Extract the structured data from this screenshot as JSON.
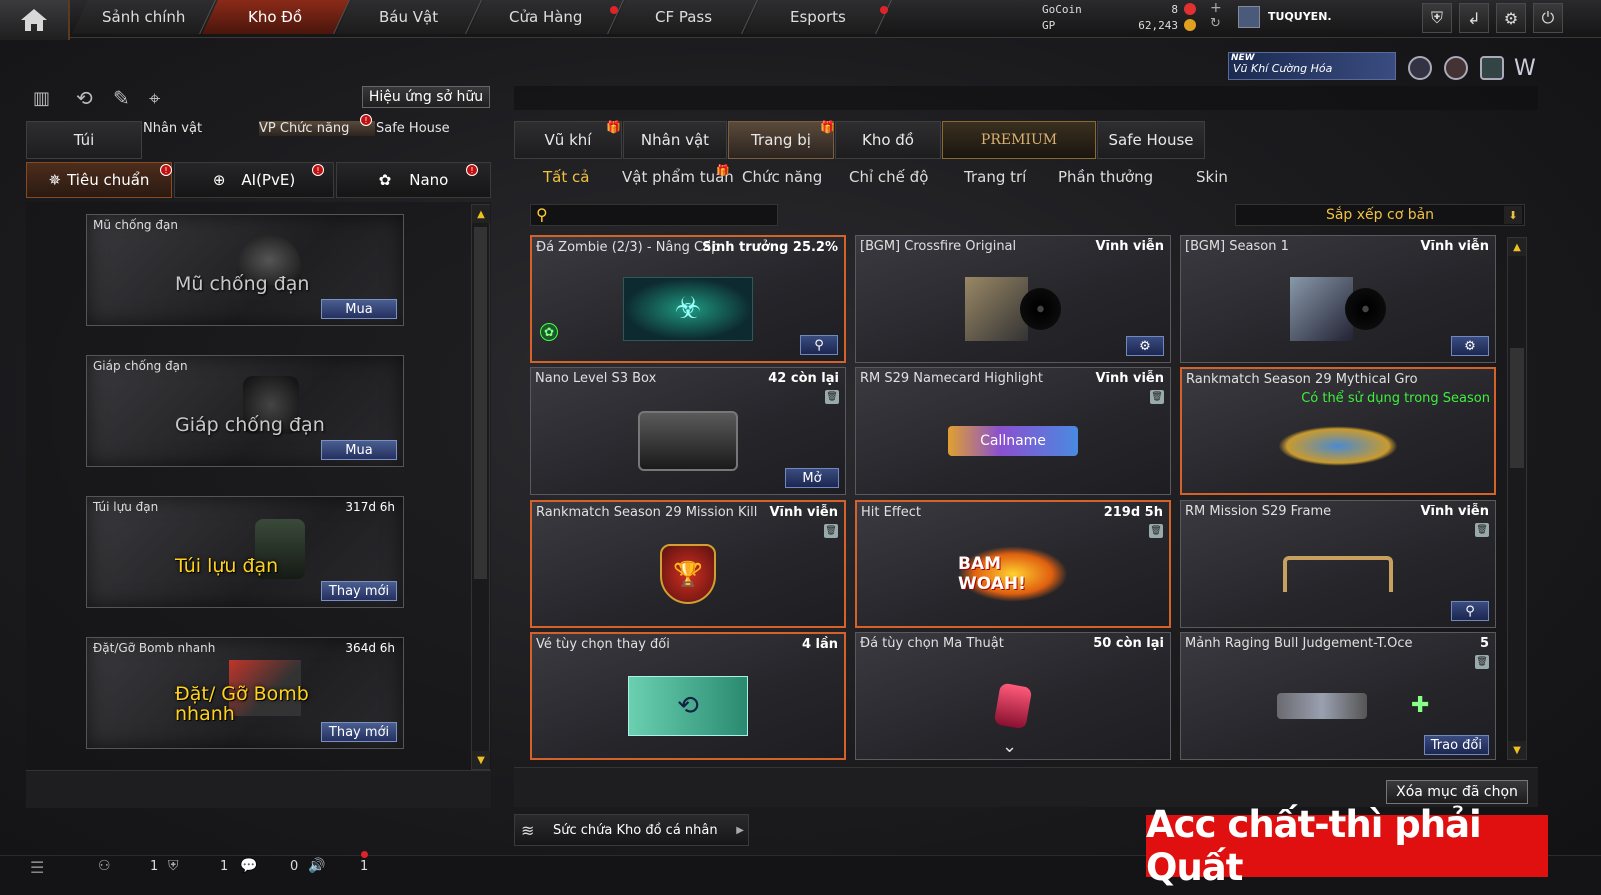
{
  "topnav": {
    "home_icon": "home-icon",
    "items": [
      {
        "label": "Sảnh chính"
      },
      {
        "label": "Kho Đồ"
      },
      {
        "label": "Báu Vật"
      },
      {
        "label": "Cửa Hàng"
      },
      {
        "label": "CF Pass"
      },
      {
        "label": "Esports"
      }
    ]
  },
  "currency": {
    "gocoin_label": "GoCoin",
    "gp_label": "GP",
    "gocoin_value": "8",
    "gp_value": "62,243"
  },
  "user": {
    "name": "TUQUYEN."
  },
  "promo_banner": {
    "new": "NEW",
    "text": "Vũ Khí Cường Hóa"
  },
  "left": {
    "effects_button": "Hiệu ứng sở hữu",
    "tabs": [
      "Túi",
      "Nhân vật",
      "VP Chức năng",
      "Safe House"
    ],
    "subtabs": [
      "Tiêu chuẩn",
      "AI(PvE)",
      "Nano"
    ],
    "items": [
      {
        "title": "Mũ chống đạn",
        "duration": "",
        "big": "Mũ chống đạn",
        "action": "Mua"
      },
      {
        "title": "Giáp chống đạn",
        "duration": "",
        "big": "Giáp chống đạn",
        "action": "Mua"
      },
      {
        "title": "Túi lựu đạn",
        "duration": "317d 6h",
        "big": "Túi lựu đạn",
        "action": "Thay mới"
      },
      {
        "title": "Đặt/Gỡ Bomb nhanh",
        "duration": "364d 6h",
        "big": "Đặt/ Gỡ Bomb nhanh",
        "action": "Thay mới"
      }
    ]
  },
  "right": {
    "tabs": [
      "Vũ khí",
      "Nhân vật",
      "Trang bị",
      "Kho đồ",
      "PREMIUM",
      "Safe House"
    ],
    "filters": [
      "Tất cả",
      "Vật phẩm tuần",
      "Chức năng",
      "Chỉ chế độ",
      "Trang trí",
      "Phần thưởng",
      "Skin"
    ],
    "search_placeholder": "",
    "sort_label": "Sắp xếp cơ bản",
    "cards": [
      {
        "name": "Đá Zombie (2/3) - Nâng Cấp",
        "status": "Sinh trưởng 25.2%"
      },
      {
        "name": "[BGM] Crossfire Original",
        "status": "Vĩnh viễn"
      },
      {
        "name": "[BGM] Season 1",
        "status": "Vĩnh viễn"
      },
      {
        "name": "Nano Level S3 Box",
        "status": "42 còn lại",
        "button": "Mở"
      },
      {
        "name": "RM S29 Namecard Highlight",
        "status": "Vĩnh viễn",
        "art_text": "Callname"
      },
      {
        "name": "Rankmatch Season 29 Mythical Gro",
        "status": "",
        "sub": "Có thể sử dụng trong Season"
      },
      {
        "name": "Rankmatch Season 29 Mission Kill",
        "status": "Vĩnh viễn"
      },
      {
        "name": "Hit Effect",
        "status": "219d 5h",
        "art_text": "BAM WOAH!"
      },
      {
        "name": "RM Mission S29 Frame",
        "status": "Vĩnh viễn"
      },
      {
        "name": "Vé tùy chọn thay đổi",
        "status": "4 lần"
      },
      {
        "name": "Đá tùy chọn Ma Thuật",
        "status": "50 còn lại"
      },
      {
        "name": "Mảnh Raging Bull Judgement-T.Oce",
        "status": "5",
        "button": "Trao đổi"
      }
    ],
    "delete_button": "Xóa mục đã chọn",
    "capacity_label": "Sức chứa Kho đồ cá nhân"
  },
  "status_bar": {
    "counts": [
      "1",
      "1",
      "0",
      "1"
    ]
  },
  "overlay_banner": "Acc chất-thì phải Quất"
}
